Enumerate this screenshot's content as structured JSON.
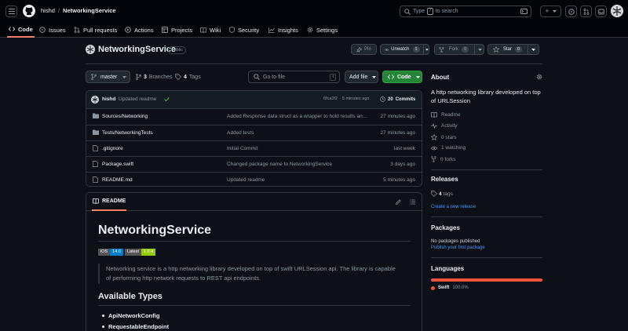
{
  "header": {
    "owner": "hishd",
    "slash": "/",
    "repo": "NetworkingService",
    "search_type": "Type",
    "search_key": "/",
    "search_rest": "to search",
    "plus": "+"
  },
  "tabs": [
    {
      "label": "Code",
      "icon": "code-icon",
      "active": true
    },
    {
      "label": "Issues",
      "icon": "issue-icon"
    },
    {
      "label": "Pull requests",
      "icon": "pull-request-icon"
    },
    {
      "label": "Actions",
      "icon": "play-icon"
    },
    {
      "label": "Projects",
      "icon": "table-icon"
    },
    {
      "label": "Wiki",
      "icon": "book-icon"
    },
    {
      "label": "Security",
      "icon": "shield-icon"
    },
    {
      "label": "Insights",
      "icon": "graph-icon"
    },
    {
      "label": "Settings",
      "icon": "gear-icon"
    }
  ],
  "repo_header": {
    "name": "NetworkingService",
    "visibility": "Public",
    "pin": "Pin",
    "unwatch": "Unwatch",
    "watch_count": "1",
    "fork": "Fork",
    "fork_count": "0",
    "star": "Star",
    "star_count": "0"
  },
  "toolbar": {
    "branch": "master",
    "branches_count": "3",
    "branches_label": "Branches",
    "tags_count": "4",
    "tags_label": "Tags",
    "goto_placeholder": "Go to file",
    "goto_key": "t",
    "add_file": "Add file",
    "code": "Code"
  },
  "commit": {
    "author": "hishd",
    "message": "Updated readme",
    "hash": "6fca3f2",
    "dot": "·",
    "time": "5 minutes ago",
    "commits_count": "20",
    "commits_label": "Commits"
  },
  "files": [
    {
      "type": "folder",
      "name": "Sources/Networking",
      "message": "Added Response data struct as a wrapper to hold results and metadata",
      "time": "27 minutes ago"
    },
    {
      "type": "folder",
      "name": "Tests/NetworkingTests",
      "message": "Added tests",
      "time": "27 minutes ago"
    },
    {
      "type": "file",
      "name": ".gitignore",
      "message": "Initial Commit",
      "time": "last week"
    },
    {
      "type": "file",
      "name": "Package.swift",
      "message": "Changed package name to NetworkingService",
      "time": "3 days ago"
    },
    {
      "type": "file",
      "name": "README.md",
      "message": "Updated readme",
      "time": "5 minutes ago"
    }
  ],
  "readme": {
    "tab_label": "README",
    "title": "NetworkingService",
    "badge1_left": "iOS",
    "badge1_right": "14.0",
    "badge2_left": "Latest",
    "badge2_right": "1.0.4",
    "description": "Networking service is a http networking library developed on top of swift URLSession api. The library is capable of performing http network requests to REST api endpoints.",
    "h2": "Available Types",
    "types": [
      "ApiNetworkConfig",
      "RequestableEndpoint"
    ]
  },
  "about": {
    "title": "About",
    "description": "A http networking library developed on top of URLSession",
    "readme": "Readme",
    "activity": "Activity",
    "stars": "0 stars",
    "watching": "1 watching",
    "forks": "0 forks"
  },
  "releases": {
    "title": "Releases",
    "tags_count": "4",
    "tags_label": "tags",
    "create_link": "Create a new release"
  },
  "packages": {
    "title": "Packages",
    "none": "No packages published",
    "publish_link": "Publish your first package"
  },
  "languages": {
    "title": "Languages",
    "items": [
      {
        "name": "Swift",
        "percent": "100.0%",
        "fraction": 1.0,
        "color": "#F05138"
      }
    ]
  },
  "colors": {
    "accent_tab": "#f78166",
    "code_button": "#238636",
    "link": "#4493f8",
    "commit_check": "#3fb950"
  }
}
